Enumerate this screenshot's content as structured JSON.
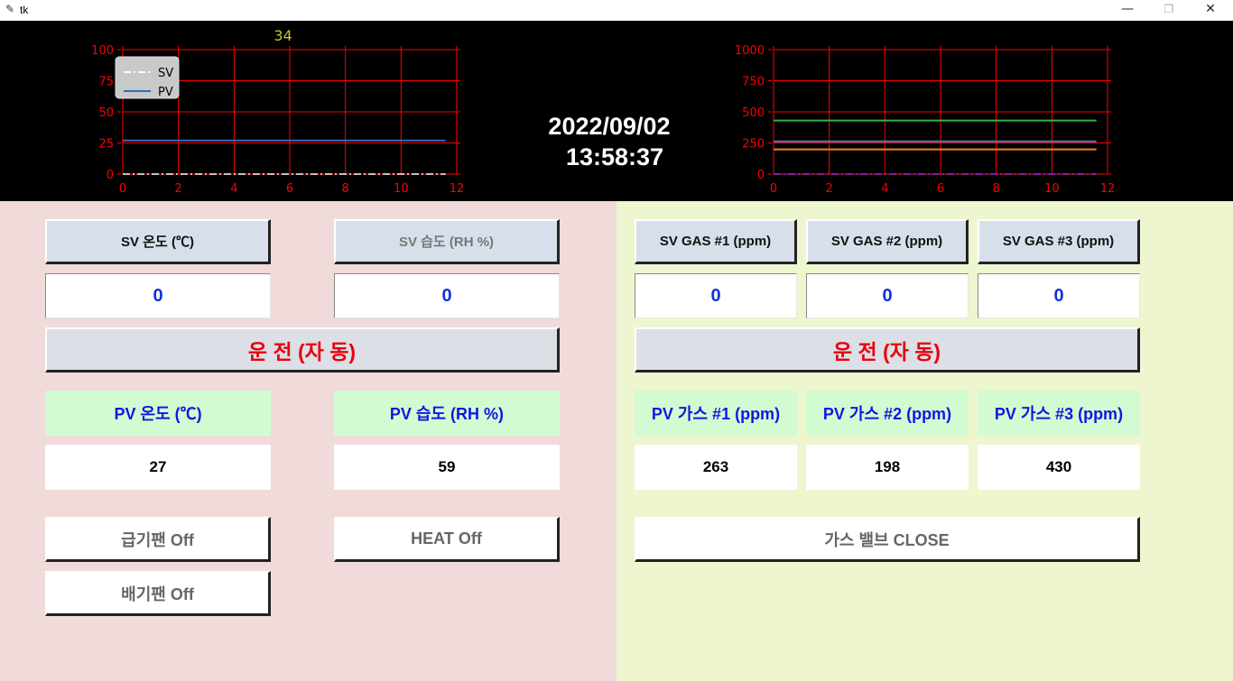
{
  "window": {
    "title": "tk",
    "minimize_glyph": "—",
    "maximize_glyph": "❐",
    "close_glyph": "✕"
  },
  "clock": {
    "date": "2022/09/02",
    "time": "13:58:37"
  },
  "chart_data": [
    {
      "type": "line",
      "title": "34",
      "xlim": [
        0,
        12
      ],
      "ylim": [
        0,
        100
      ],
      "xticks": [
        "0",
        "2",
        "4",
        "6",
        "8",
        "10",
        "12"
      ],
      "yticks": [
        "0",
        "25",
        "50",
        "75",
        "100"
      ],
      "grid": true,
      "legend": "top-left",
      "colors": {
        "axis": "#ff0000",
        "grid": "#ff0000",
        "title": "#c8c81e",
        "legend_bg": "#c9c9c9"
      },
      "series": [
        {
          "name": "SV",
          "style": "dashdot",
          "color": "#ffffff",
          "x": [
            0,
            11.6
          ],
          "y": [
            0,
            0
          ]
        },
        {
          "name": "PV",
          "style": "solid",
          "color": "#2f6fb8",
          "x": [
            0,
            11.6
          ],
          "y": [
            27,
            27
          ]
        }
      ]
    },
    {
      "type": "line",
      "xlim": [
        0,
        12
      ],
      "ylim": [
        0,
        1000
      ],
      "xticks": [
        "0",
        "2",
        "4",
        "6",
        "8",
        "10",
        "12"
      ],
      "yticks": [
        "0",
        "250",
        "500",
        "750",
        "1000"
      ],
      "grid": true,
      "colors": {
        "axis": "#ff0000",
        "grid": "#ff0000"
      },
      "series": [
        {
          "style": "solid",
          "color": "#3fae3f",
          "x": [
            0,
            11.6
          ],
          "y": [
            430,
            430
          ]
        },
        {
          "style": "solid",
          "color": "#4a7fd0",
          "x": [
            0,
            11.6
          ],
          "y": [
            263,
            263
          ]
        },
        {
          "style": "solid",
          "color": "#ff7f0e",
          "x": [
            0,
            11.6
          ],
          "y": [
            198,
            198
          ]
        },
        {
          "style": "dashdot",
          "color": "#9b30d0",
          "x": [
            0,
            11.6
          ],
          "y": [
            0,
            0
          ]
        }
      ]
    }
  ],
  "left": {
    "sv_temp_button": "SV 온도 (℃)",
    "sv_humid_button": "SV 습도 (RH %)",
    "sv_temp_value": "0",
    "sv_humid_value": "0",
    "run_button": "운 전 (자 동)",
    "pv_temp_label": "PV 온도 (℃)",
    "pv_humid_label": "PV 습도 (RH %)",
    "pv_temp_value": "27",
    "pv_humid_value": "59",
    "intake_fan_button": "급기팬 Off",
    "heat_button": "HEAT Off",
    "exhaust_fan_button": "배기팬 Off"
  },
  "right": {
    "sv_gas1_button": "SV GAS #1 (ppm)",
    "sv_gas2_button": "SV GAS #2 (ppm)",
    "sv_gas3_button": "SV GAS #3 (ppm)",
    "sv_gas1_value": "0",
    "sv_gas2_value": "0",
    "sv_gas3_value": "0",
    "run_button": "운 전 (자 동)",
    "pv_gas1_label": "PV 가스 #1 (ppm)",
    "pv_gas2_label": "PV 가스 #2 (ppm)",
    "pv_gas3_label": "PV 가스 #3 (ppm)",
    "pv_gas1_value": "263",
    "pv_gas2_value": "198",
    "pv_gas3_value": "430",
    "gas_valve_button": "가스 밸브 CLOSE"
  }
}
